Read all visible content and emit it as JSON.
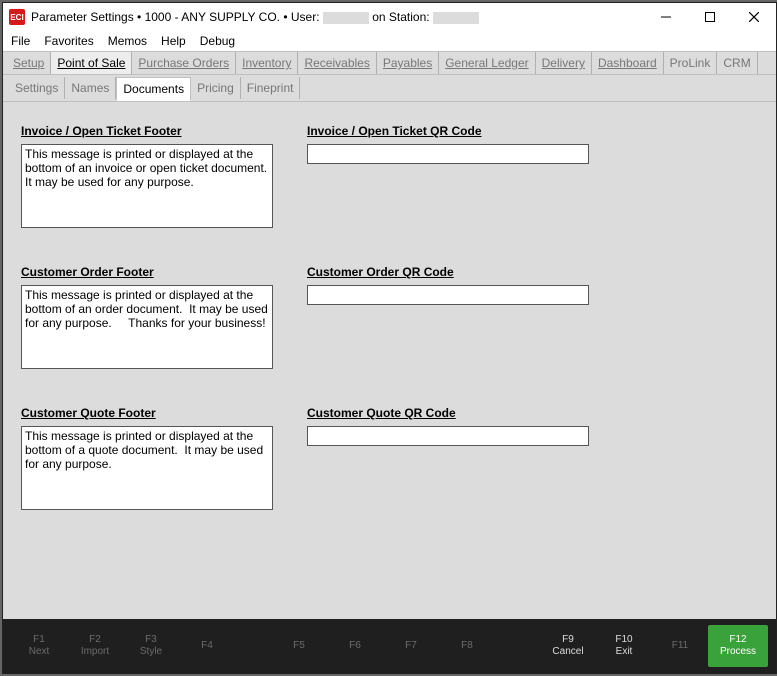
{
  "title": {
    "prefix": "Parameter Settings  •  1000 - ANY SUPPLY CO.  •  User:",
    "mid": "on Station:"
  },
  "app_icon_text": "ECI",
  "menu": {
    "file": "File",
    "favorites": "Favorites",
    "memos": "Memos",
    "help": "Help",
    "debug": "Debug"
  },
  "tabs": {
    "setup": "Setup",
    "pos": "Point of Sale",
    "po": "Purchase Orders",
    "inv": "Inventory",
    "recv": "Receivables",
    "pay": "Payables",
    "gl": "General Ledger",
    "delivery": "Delivery",
    "dash": "Dashboard",
    "prolink": "ProLink",
    "crm": "CRM"
  },
  "subtabs": {
    "settings": "Settings",
    "names": "Names",
    "documents": "Documents",
    "pricing": "Pricing",
    "fineprint": "Fineprint"
  },
  "sections": {
    "inv_footer_label": "Invoice / Open Ticket Footer",
    "inv_footer_value": "This message is printed or displayed at the bottom of an invoice or open ticket document.  It may be used for any purpose.",
    "inv_qr_label": "Invoice / Open Ticket QR Code",
    "inv_qr_value": "",
    "ord_footer_label": "Customer Order Footer",
    "ord_footer_value": "This message is printed or displayed at the bottom of an order document.  It may be used for any purpose.     Thanks for your business!",
    "ord_qr_label": "Customer Order QR Code",
    "ord_qr_value": "",
    "quo_footer_label": "Customer Quote Footer",
    "quo_footer_value": "This message is printed or displayed at the bottom of a quote document.  It may be used for any purpose.",
    "quo_qr_label": "Customer Quote QR Code",
    "quo_qr_value": ""
  },
  "fn": {
    "f1k": "F1",
    "f1l": "Next",
    "f2k": "F2",
    "f2l": "Import",
    "f3k": "F3",
    "f3l": "Style",
    "f4k": "F4",
    "f4l": "",
    "f5k": "F5",
    "f5l": "",
    "f6k": "F6",
    "f6l": "",
    "f7k": "F7",
    "f7l": "",
    "f8k": "F8",
    "f8l": "",
    "f9k": "F9",
    "f9l": "Cancel",
    "f10k": "F10",
    "f10l": "Exit",
    "f11k": "F11",
    "f11l": "",
    "f12k": "F12",
    "f12l": "Process"
  }
}
